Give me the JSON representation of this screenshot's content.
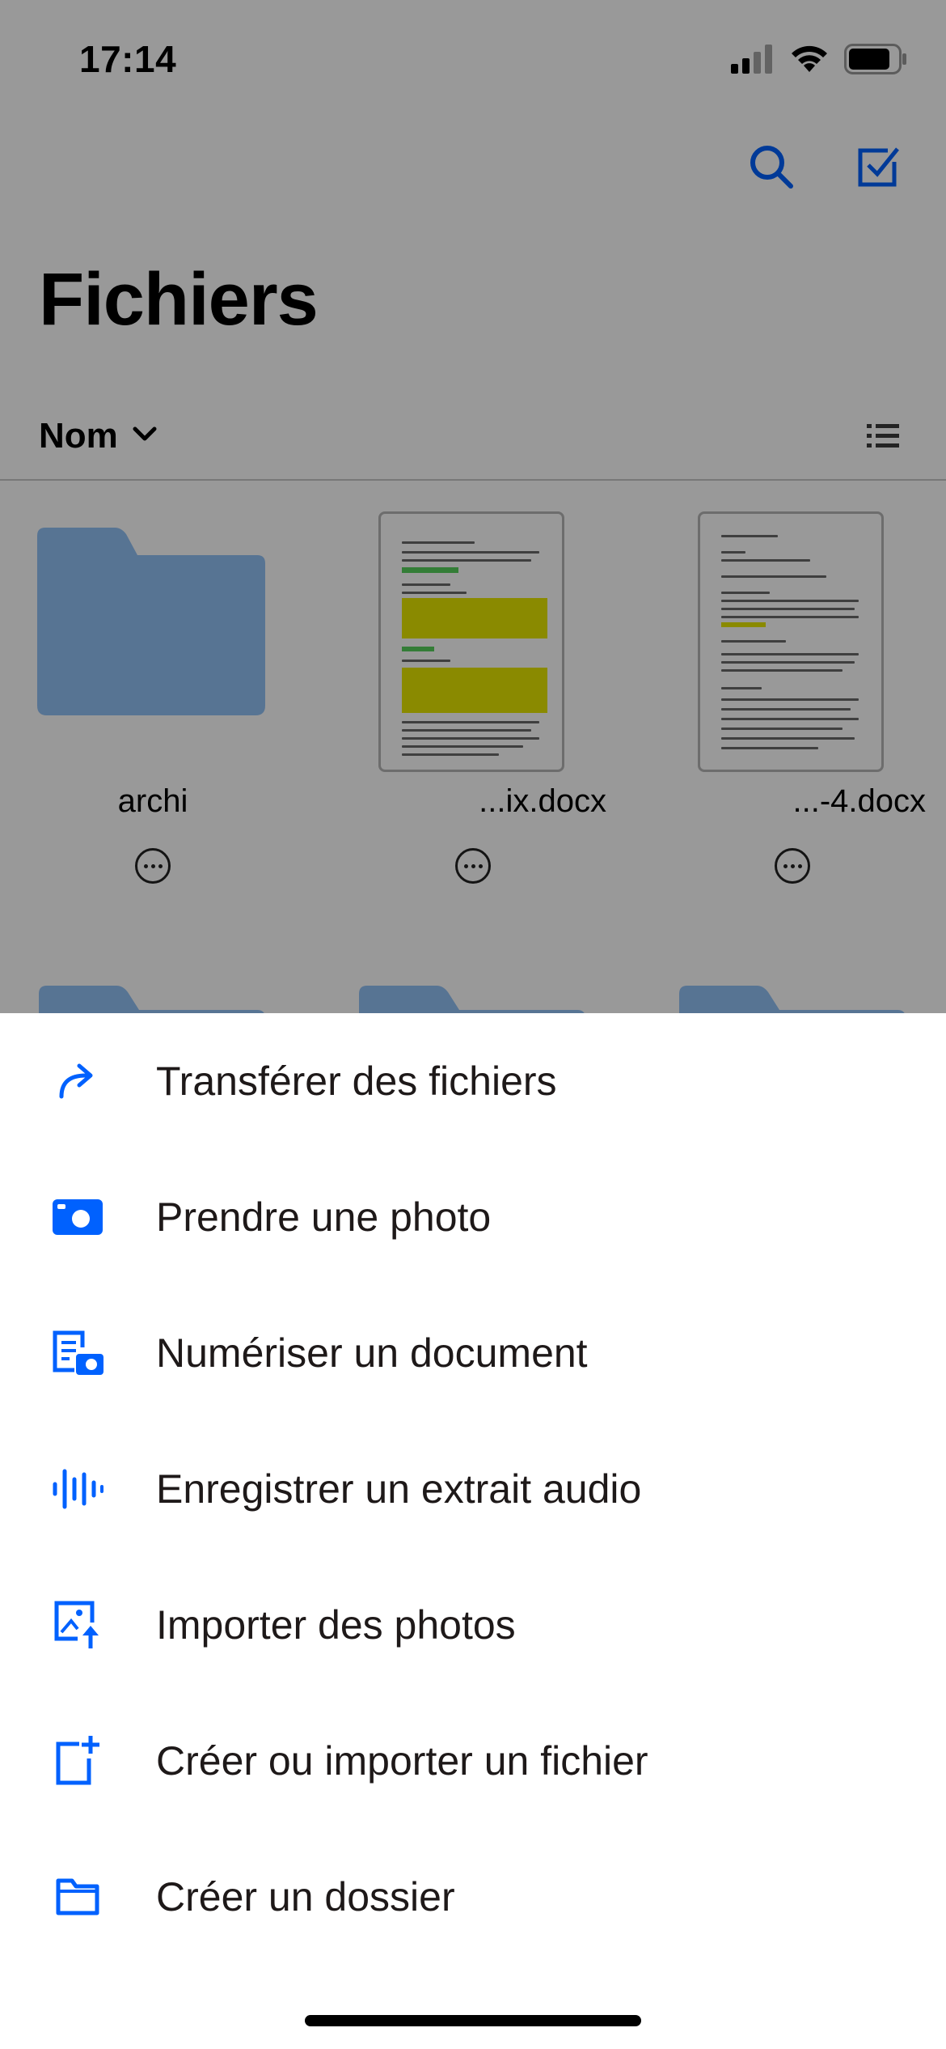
{
  "status_bar": {
    "time": "17:14"
  },
  "header": {
    "title": "Fichiers",
    "search_icon": "search-icon",
    "select_icon": "checkbox-select-icon"
  },
  "sort": {
    "label": "Nom",
    "view_icon": "list-view-icon"
  },
  "files": [
    {
      "name": "archi",
      "type": "folder"
    },
    {
      "name": "...ix.docx",
      "type": "document"
    },
    {
      "name": "...-4.docx",
      "type": "document"
    }
  ],
  "sheet": {
    "items": [
      {
        "label": "Transférer des fichiers",
        "icon": "share-arrow-icon"
      },
      {
        "label": "Prendre une photo",
        "icon": "camera-icon"
      },
      {
        "label": "Numériser un document",
        "icon": "scan-document-icon"
      },
      {
        "label": "Enregistrer un extrait audio",
        "icon": "audio-waveform-icon"
      },
      {
        "label": "Importer des photos",
        "icon": "upload-photo-icon"
      },
      {
        "label": "Créer ou importer un fichier",
        "icon": "new-file-icon"
      },
      {
        "label": "Créer un dossier",
        "icon": "folder-icon"
      }
    ]
  },
  "colors": {
    "accent": "#0061FE",
    "folder": "#92C1F6",
    "text": "#1E1919"
  }
}
